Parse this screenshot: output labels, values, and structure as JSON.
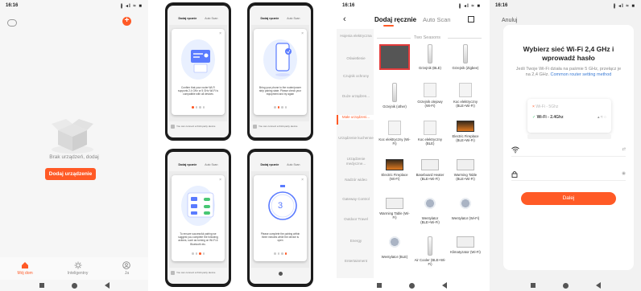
{
  "status": {
    "time": "16:16",
    "right_icons": "∦ ◂l ≈ ■"
  },
  "panel1": {
    "empty_text": "Brak urządzeń, dodaj",
    "add_device_button": "Dodaj urządzenie",
    "tabs": [
      {
        "label": "Mój dom",
        "icon": "home-icon",
        "active": true
      },
      {
        "label": "Inteligentny",
        "icon": "sun-icon",
        "active": false
      },
      {
        "label": "Ja",
        "icon": "person-icon",
        "active": false
      }
    ],
    "accent": "#ff5a26"
  },
  "panel2": {
    "header_title": "Dodaj ręcznie",
    "header_tab2": "Auto Scan",
    "footer_text": "You can connect a third-party device",
    "screens": [
      {
        "caption": "Confirm that your router Wi-Fi supports 2.4 GHz or 5 GHz Wi-Fi is compatible with all devices",
        "active_dot": 0
      },
      {
        "caption": "Bring your phone to the router/power strip pairing state. Please check your equipment and try again",
        "active_dot": 1
      },
      {
        "caption": "To ensure successful pairing we suggest you complete the following actions, such as turning on Wi-Fi & Bluetooth etc.",
        "active_dot": 2
      },
      {
        "caption": "Please complete the pairing within three minutes while the device is open",
        "countdown": "3",
        "active_dot": 3
      }
    ]
  },
  "panel3": {
    "tab_manual": "Dodaj ręcznie",
    "tab_auto": "Auto Scan",
    "categories": [
      {
        "label": "Hojenia elektryczna",
        "active": false
      },
      {
        "label": "Oświetlenie",
        "active": false
      },
      {
        "label": "Czujnik ochrony",
        "active": false
      },
      {
        "label": "Duże urządzen...",
        "active": false
      },
      {
        "label": "Małe urządzeni...",
        "active": true
      },
      {
        "label": "Urządzenie kuchenne",
        "active": false
      },
      {
        "label": "Urządzenie medyczne...",
        "active": false
      },
      {
        "label": "Nadzór wideo",
        "active": false
      },
      {
        "label": "Gateway Control",
        "active": false
      },
      {
        "label": "Outdoor Travel",
        "active": false
      },
      {
        "label": "Energy",
        "active": false
      },
      {
        "label": "Entertainment",
        "active": false
      }
    ],
    "section_title": "Two Seasons",
    "devices": [
      {
        "label": "",
        "selected": true
      },
      {
        "label": "Grzejnik (BLE)"
      },
      {
        "label": "Grzejnik (Zigbee)"
      },
      {
        "label": "Grzejnik (other)"
      },
      {
        "label": "Grzejnik olejowy (Wi-Fi)"
      },
      {
        "label": "Koc elektryczny (BLE+Wi-Fi)"
      },
      {
        "label": "Koc elektryczny (Wi-Fi)"
      },
      {
        "label": "Koc elektryczny (BLE)"
      },
      {
        "label": "Electric Fireplace (BLE+Wi-Fi)"
      },
      {
        "label": "Electric Fireplace (Wi-Fi)"
      },
      {
        "label": "Baseboard Heater (BLE+Wi-Fi)"
      },
      {
        "label": "Warming Table (BLE+Wi-Fi)"
      },
      {
        "label": "Warming Table (Wi-Fi)"
      },
      {
        "label": "Wentylator (BLE+Wi-Fi)"
      },
      {
        "label": "Wentylator (Wi-Fi)"
      },
      {
        "label": "Wentylator (BLE)"
      },
      {
        "label": "Air Cooler (BLE+Wi-Fi)"
      },
      {
        "label": "Klimatyzator (Wi-Fi)"
      }
    ]
  },
  "panel4": {
    "cancel": "Anuluj",
    "title_line1": "Wybierz sieć Wi-Fi 2,4 GHz i",
    "title_line2": "wprowadź hasło",
    "note": "Jeśli Twoje Wi-Fi działa na paśmie 5 GHz, przełącz je na 2,4 GHz.",
    "note_link": "Common router setting method",
    "wifi_5g": "Wi-Fi - 5Ghz",
    "wifi_24g": "Wi-Fi - 2.4Ghz",
    "ssid_hint": "",
    "next_button": "Dalej"
  }
}
